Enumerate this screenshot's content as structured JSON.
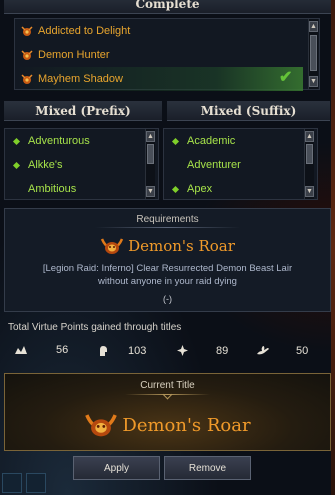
{
  "complete": {
    "header": "Complete",
    "items": [
      {
        "label": "Addicted to Delight"
      },
      {
        "label": "Demon Hunter"
      },
      {
        "label": "Mayhem Shadow",
        "selected": true
      }
    ]
  },
  "mixed_prefix": {
    "header": "Mixed (Prefix)",
    "items": [
      {
        "label": "Adventurous",
        "bullet": true
      },
      {
        "label": "Alkke's",
        "bullet": true
      },
      {
        "label": "Ambitious",
        "bullet": false
      }
    ]
  },
  "mixed_suffix": {
    "header": "Mixed (Suffix)",
    "items": [
      {
        "label": "Academic",
        "bullet": true
      },
      {
        "label": "Adventurer",
        "bullet": false
      },
      {
        "label": "Apex",
        "bullet": true
      }
    ]
  },
  "requirements": {
    "header": "Requirements",
    "title": "Demon's Roar",
    "description_line1": "[Legion Raid: Inferno] Clear Resurrected Demon Beast Lair",
    "description_line2": "without anyone in your raid dying",
    "progress": "(-)"
  },
  "virtue": {
    "label": "Total Virtue Points gained through titles",
    "values": [
      {
        "icon": "wisdom-icon",
        "value": "56"
      },
      {
        "icon": "courage-icon",
        "value": "103"
      },
      {
        "icon": "charisma-icon",
        "value": "89"
      },
      {
        "icon": "kindness-icon",
        "value": "50"
      }
    ]
  },
  "current_title": {
    "label": "Current Title",
    "name": "Demon's Roar"
  },
  "buttons": {
    "apply": "Apply",
    "remove": "Remove"
  },
  "colors": {
    "title_gold": "#e8a52e",
    "mixed_green": "#a6e24a",
    "demon_orange": "#f09a2a"
  }
}
